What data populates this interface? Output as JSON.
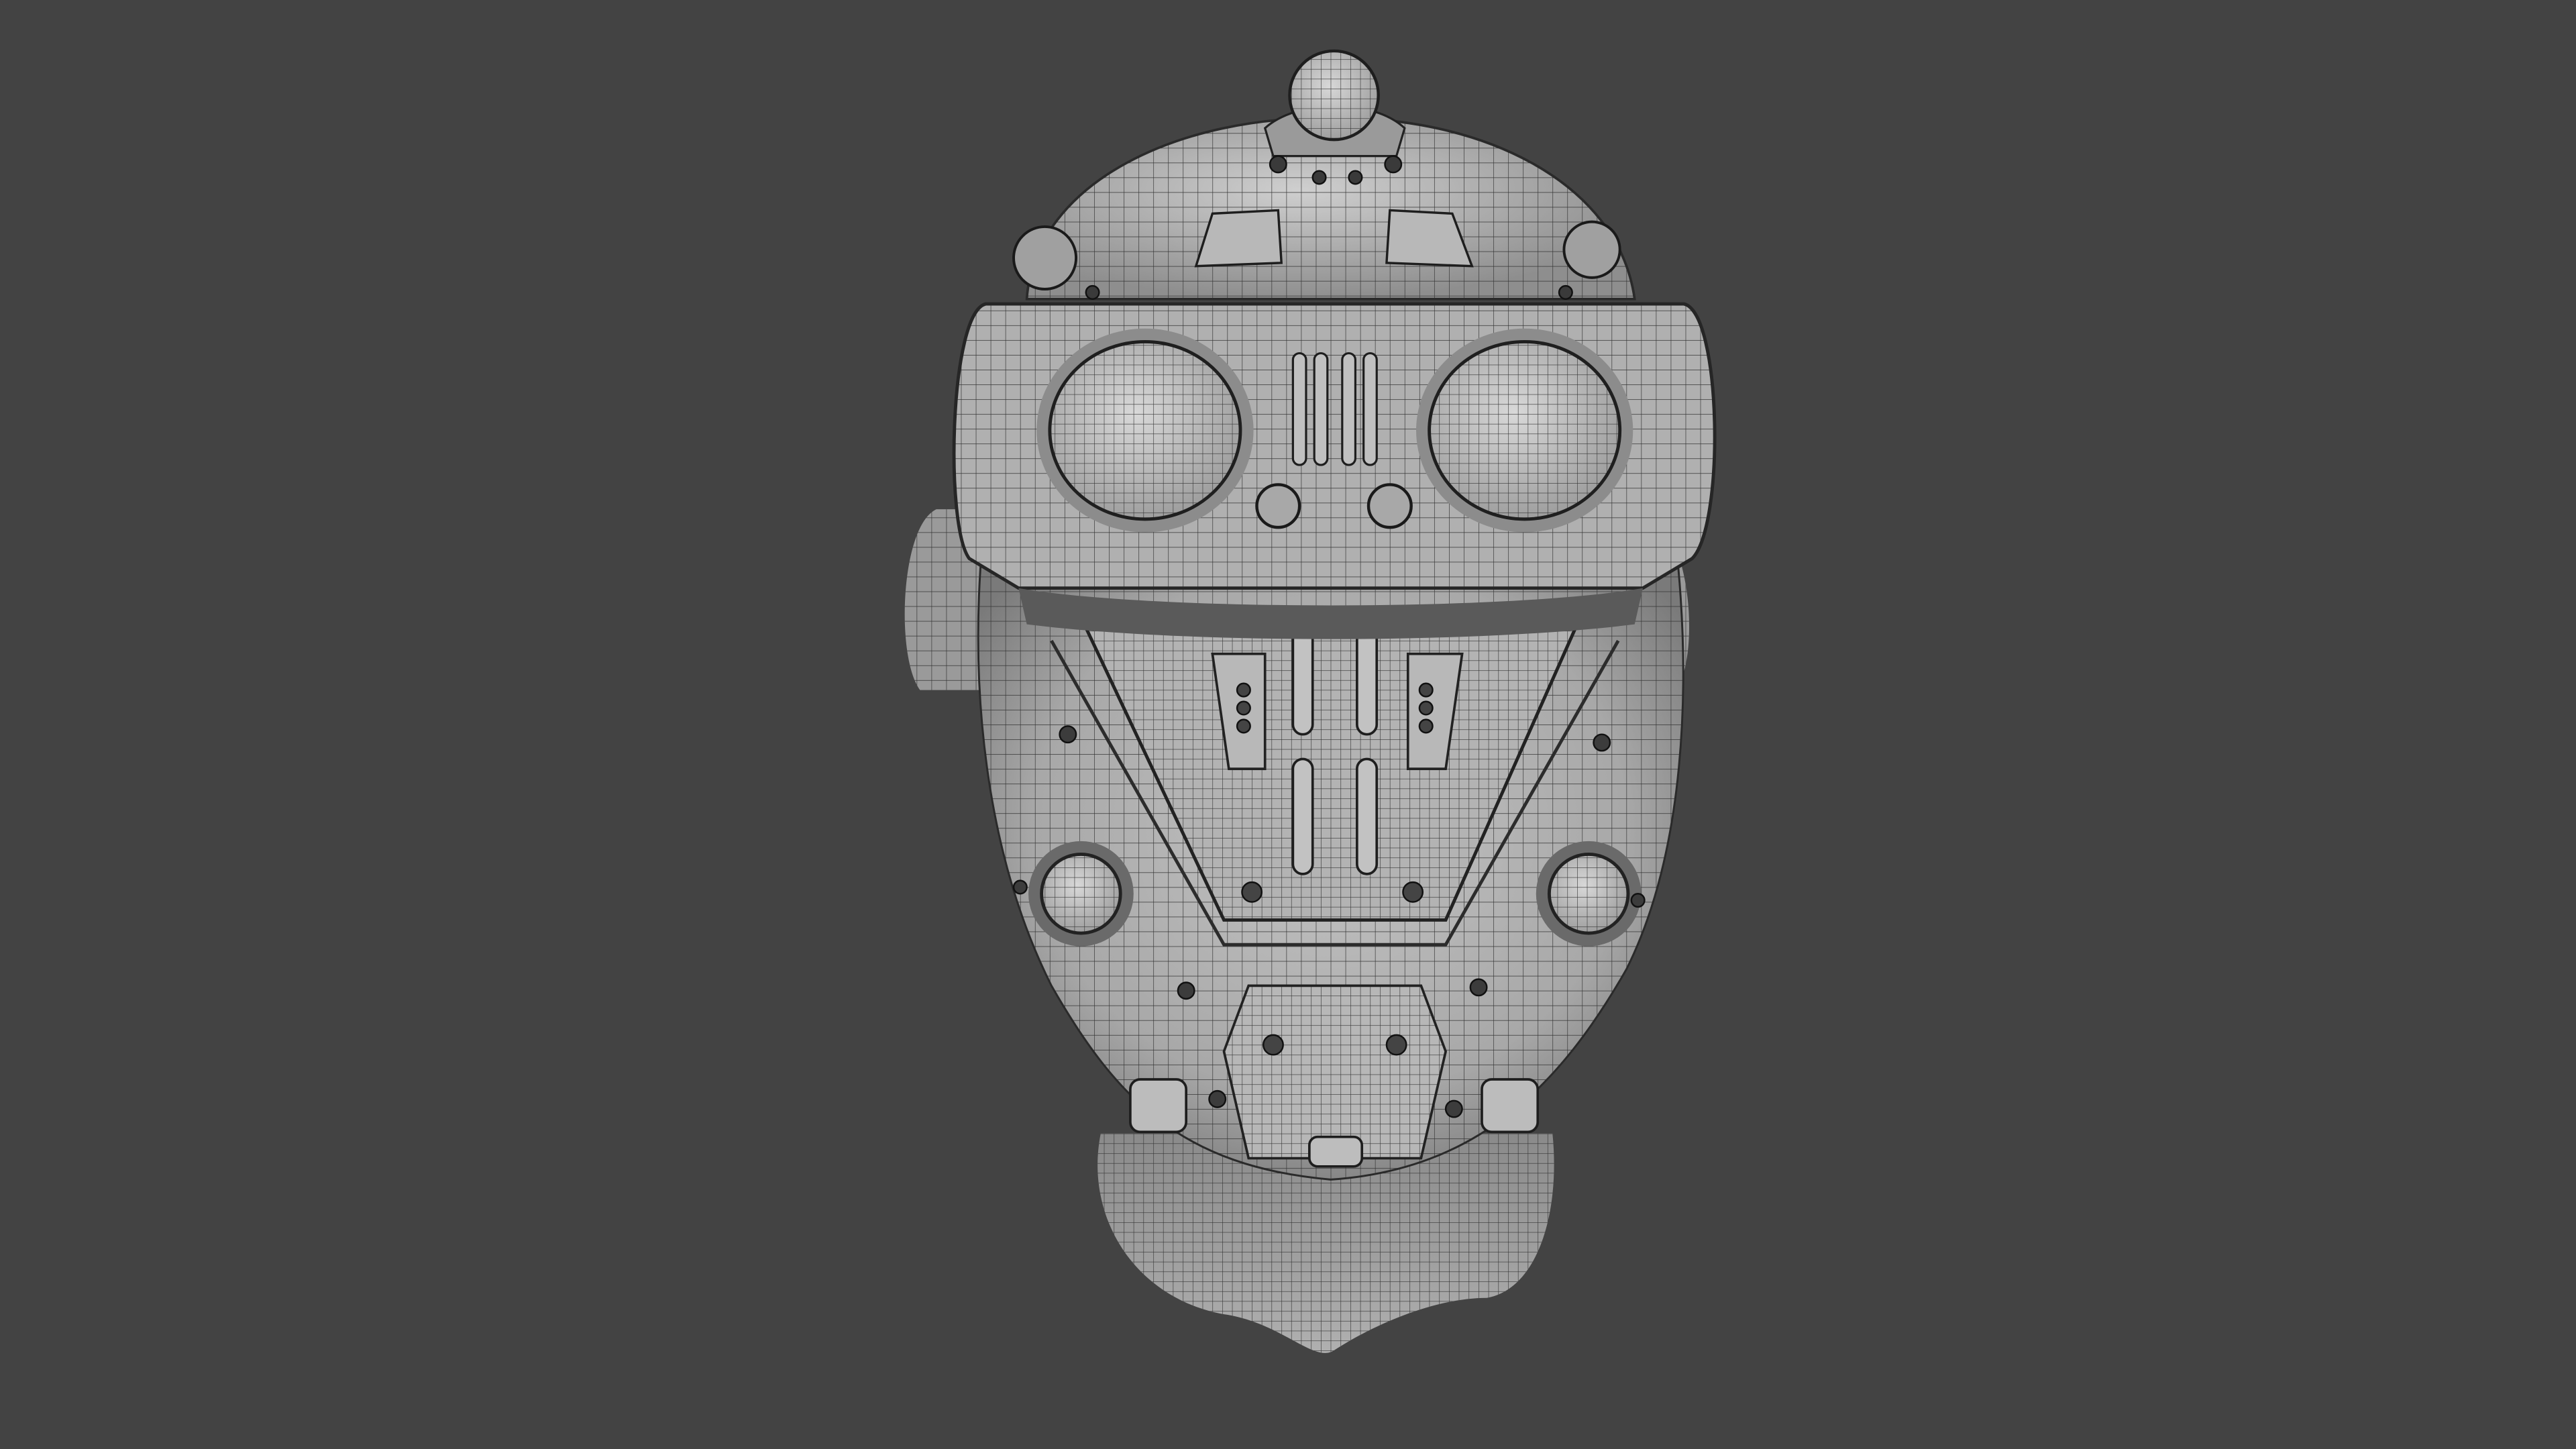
{
  "scene": {
    "subject": "wireframe-robot-head",
    "render_mode": "wireframe-on-shaded",
    "colors": {
      "background": "#434343",
      "surface_light": "#b5b5b5",
      "surface_mid": "#9a9a9a",
      "surface_dark": "#707070",
      "wire": "#2a2a2a",
      "shadow": "#3a3a3a"
    }
  }
}
